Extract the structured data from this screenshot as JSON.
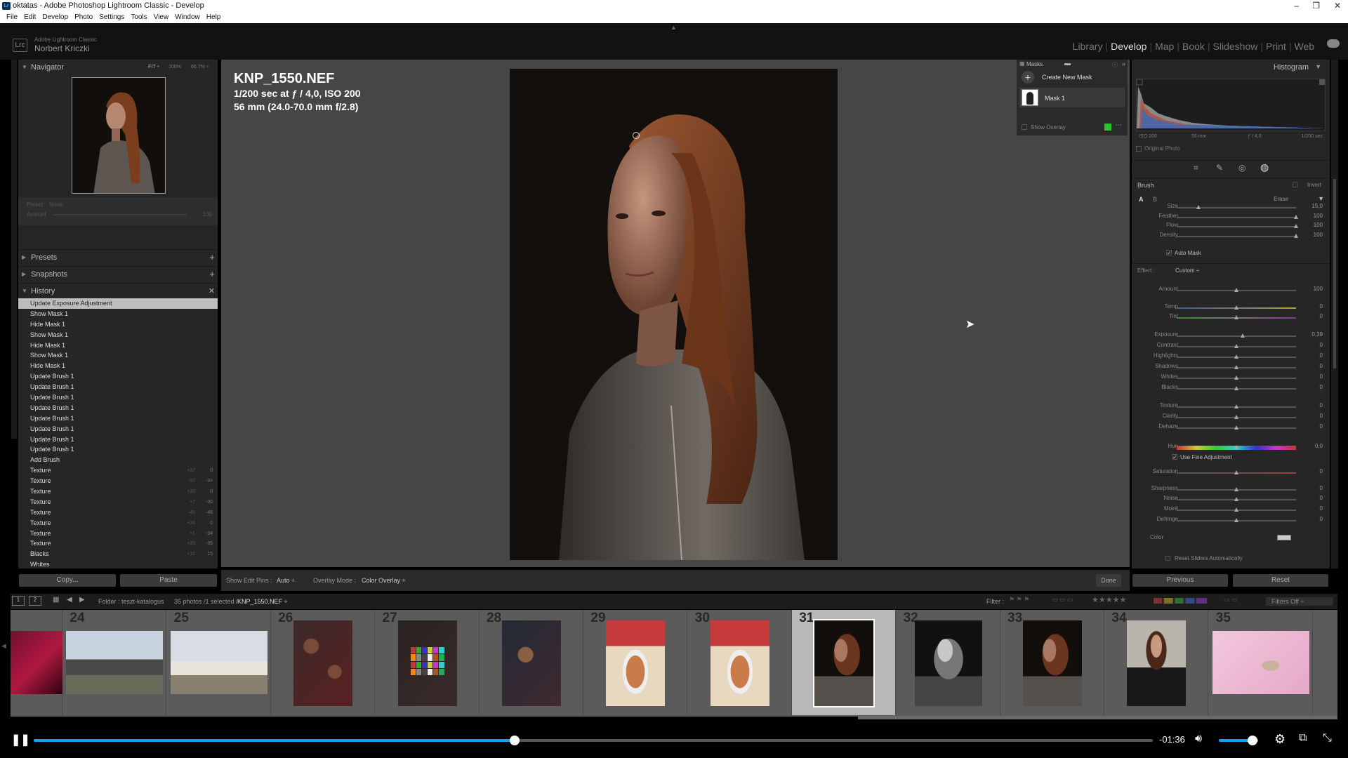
{
  "window": {
    "title": "oktatas - Adobe Photoshop Lightroom Classic - Develop"
  },
  "menu": [
    "File",
    "Edit",
    "Develop",
    "Photo",
    "Settings",
    "Tools",
    "View",
    "Window",
    "Help"
  ],
  "identity": {
    "logo": "Lrc",
    "app": "Adobe Lightroom Classic",
    "user": "Norbert Kriczki"
  },
  "modules": [
    "Library",
    "Develop",
    "Map",
    "Book",
    "Slideshow",
    "Print",
    "Web"
  ],
  "active_module": "Develop",
  "navigator": {
    "title": "Navigator",
    "zoom": [
      "FIT ÷",
      "100%",
      "66.7% ÷"
    ],
    "preset_label": "Preset",
    "preset_value": "None",
    "amount_label": "Amount",
    "amount_value": "100"
  },
  "panels": {
    "presets": "Presets",
    "snapshots": "Snapshots",
    "history": "History"
  },
  "history": [
    {
      "label": "Update Exposure Adjustment",
      "sel": true
    },
    {
      "label": "Show Mask 1"
    },
    {
      "label": "Hide Mask 1"
    },
    {
      "label": "Show Mask 1"
    },
    {
      "label": "Hide Mask 1"
    },
    {
      "label": "Show Mask 1"
    },
    {
      "label": "Hide Mask 1"
    },
    {
      "label": "Update Brush 1"
    },
    {
      "label": "Update Brush 1"
    },
    {
      "label": "Update Brush 1"
    },
    {
      "label": "Update Brush 1"
    },
    {
      "label": "Update Brush 1"
    },
    {
      "label": "Update Brush 1"
    },
    {
      "label": "Update Brush 1"
    },
    {
      "label": "Update Brush 1"
    },
    {
      "label": "Add Brush"
    },
    {
      "label": "Texture",
      "v1": "+37",
      "v2": "0"
    },
    {
      "label": "Texture",
      "v1": "-37",
      "v2": "-37"
    },
    {
      "label": "Texture",
      "v1": "+30",
      "v2": "0"
    },
    {
      "label": "Texture",
      "v1": "+7",
      "v2": "-30"
    },
    {
      "label": "Texture",
      "v1": "-46",
      "v2": "-46"
    },
    {
      "label": "Texture",
      "v1": "+34",
      "v2": "0"
    },
    {
      "label": "Texture",
      "v1": "+1",
      "v2": "-34"
    },
    {
      "label": "Texture",
      "v1": "+35",
      "v2": "-35"
    },
    {
      "label": "Blacks",
      "v1": "+15",
      "v2": "15"
    },
    {
      "label": "Whites",
      "v1": "",
      "v2": ""
    }
  ],
  "left_buttons": {
    "copy": "Copy...",
    "paste": "Paste"
  },
  "photo_info": {
    "filename": "KNP_1550.NEF",
    "exposure": "1/200 sec at ƒ / 4,0, ISO 200",
    "lens": "56 mm (24.0-70.0 mm f/2.8)"
  },
  "masks": {
    "title": "Masks",
    "create": "Create New Mask",
    "mask_name": "Mask 1",
    "show_overlay": "Show Overlay",
    "overlay_color": "#29c229"
  },
  "histogram": {
    "title": "Histogram",
    "iso": "ISO 200",
    "focal": "56 mm",
    "fstop": "ƒ / 4,0",
    "shutter": "1/200 sec",
    "original_photo": "Original Photo"
  },
  "brush": {
    "title": "Brush",
    "invert": "Invert",
    "a": "A",
    "b": "B",
    "erase": "Erase",
    "sliders": [
      {
        "label": "Size",
        "value": "15,0",
        "pos": 0.18
      },
      {
        "label": "Feather",
        "value": "100",
        "pos": 1
      },
      {
        "label": "Flow",
        "value": "100",
        "pos": 1
      },
      {
        "label": "Density",
        "value": "100",
        "pos": 1
      }
    ],
    "auto_mask": "Auto Mask"
  },
  "effect": {
    "label": "Effect :",
    "preset": "Custom ÷",
    "amount_label": "Amount",
    "amount_value": "100",
    "sliders": [
      {
        "label": "Temp",
        "value": "0",
        "pos": 0.5
      },
      {
        "label": "Tint",
        "value": "0",
        "pos": 0.5
      },
      {
        "label": "Exposure",
        "value": "0,39",
        "pos": 0.55
      },
      {
        "label": "Contrast",
        "value": "0",
        "pos": 0.5
      },
      {
        "label": "Highlights",
        "value": "0",
        "pos": 0.5
      },
      {
        "label": "Shadows",
        "value": "0",
        "pos": 0.5
      },
      {
        "label": "Whites",
        "value": "0",
        "pos": 0.5
      },
      {
        "label": "Blacks",
        "value": "0",
        "pos": 0.5
      },
      {
        "label": "Texture",
        "value": "0",
        "pos": 0.5
      },
      {
        "label": "Clarity",
        "value": "0",
        "pos": 0.5
      },
      {
        "label": "Dehaze",
        "value": "0",
        "pos": 0.5
      },
      {
        "label": "Hue",
        "value": "0,0",
        "pos": 0.5
      },
      {
        "label": "Saturation",
        "value": "0",
        "pos": 0.5
      },
      {
        "label": "Sharpness",
        "value": "0",
        "pos": 0.5
      },
      {
        "label": "Noise",
        "value": "0",
        "pos": 0.5
      },
      {
        "label": "Moiré",
        "value": "0",
        "pos": 0.5
      },
      {
        "label": "Defringe",
        "value": "0",
        "pos": 0.5
      }
    ],
    "fine": "Use Fine Adjustment",
    "color": "Color",
    "reset_auto": "Reset Sliders Automatically"
  },
  "right_buttons": {
    "previous": "Previous",
    "reset": "Reset"
  },
  "toolbar": {
    "show_pins_label": "Show Edit Pins :",
    "show_pins_value": "Auto ÷",
    "overlay_mode_label": "Overlay Mode :",
    "overlay_mode_value": "Color Overlay ÷",
    "done": "Done"
  },
  "filmbar": {
    "views": [
      "1",
      "2"
    ],
    "folder": "Folder : teszt-katalogus",
    "count": "35 photos /1 selected /",
    "file": "KNP_1550.NEF ÷",
    "filter": "Filter :",
    "filters_off": "Filters Off ÷"
  },
  "filmstrip": [
    {
      "n": "",
      "kind": "concert"
    },
    {
      "n": "24",
      "kind": "house"
    },
    {
      "n": "25",
      "kind": "house2"
    },
    {
      "n": "26",
      "kind": "choc"
    },
    {
      "n": "27",
      "kind": "checker"
    },
    {
      "n": "28",
      "kind": "choc2"
    },
    {
      "n": "29",
      "kind": "soup"
    },
    {
      "n": "30",
      "kind": "soup"
    },
    {
      "n": "31",
      "kind": "portrait",
      "sel": true
    },
    {
      "n": "32",
      "kind": "bw"
    },
    {
      "n": "33",
      "kind": "portrait"
    },
    {
      "n": "34",
      "kind": "portrait2"
    },
    {
      "n": "35",
      "kind": "pink"
    }
  ],
  "player": {
    "time": "-01:36",
    "progress": 0.43,
    "volume": 0.85
  }
}
